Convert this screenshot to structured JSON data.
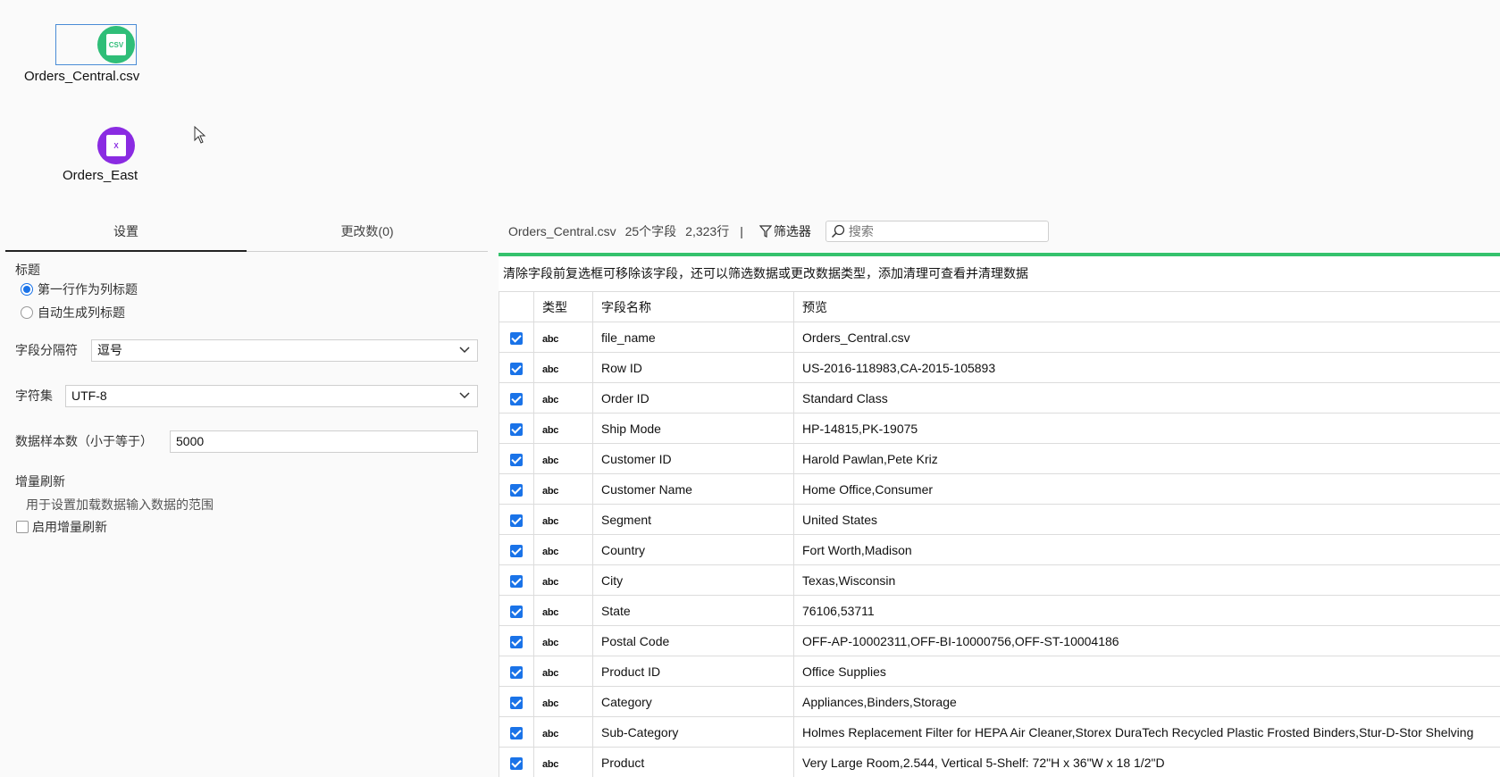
{
  "canvas": {
    "nodes": [
      {
        "label": "Orders_Central.csv",
        "icon": "csv-file-icon",
        "glyph": "CSV",
        "color": "#2fbe78"
      },
      {
        "label": "Orders_East",
        "icon": "excel-file-icon",
        "glyph": "X",
        "color": "#8a2be2"
      }
    ]
  },
  "settings": {
    "tabs": [
      {
        "label": "设置"
      },
      {
        "label": "更改数(0)"
      }
    ],
    "header_section": {
      "label": "标题",
      "options": [
        {
          "label": "第一行作为列标题",
          "selected": true
        },
        {
          "label": "自动生成列标题",
          "selected": false
        }
      ]
    },
    "delimiter": {
      "label": "字段分隔符",
      "value": "逗号"
    },
    "charset": {
      "label": "字符集",
      "value": "UTF-8"
    },
    "sample": {
      "label": "数据样本数（小于等于）",
      "value": "5000"
    },
    "incremental": {
      "label": "增量刷新",
      "description": "用于设置加载数据输入数据的范围",
      "checkbox_label": "启用增量刷新"
    }
  },
  "toolbar": {
    "file_name": "Orders_Central.csv",
    "field_count": "25个字段",
    "row_count": "2,323行",
    "separator": "|",
    "filter_label": "筛选器",
    "search_placeholder": "搜索"
  },
  "hint": "清除字段前复选框可移除该字段，还可以筛选数据或更改数据类型，添加清理可查看并清理数据",
  "table": {
    "columns": [
      "",
      "类型",
      "字段名称",
      "预览"
    ],
    "rows": [
      {
        "type": "abc",
        "name": "file_name",
        "preview": "Orders_Central.csv"
      },
      {
        "type": "abc",
        "name": "Row ID",
        "preview": "US-2016-118983,CA-2015-105893"
      },
      {
        "type": "abc",
        "name": "Order ID",
        "preview": "Standard Class"
      },
      {
        "type": "abc",
        "name": "Ship Mode",
        "preview": "HP-14815,PK-19075"
      },
      {
        "type": "abc",
        "name": "Customer ID",
        "preview": "Harold Pawlan,Pete Kriz"
      },
      {
        "type": "abc",
        "name": "Customer Name",
        "preview": "Home Office,Consumer"
      },
      {
        "type": "abc",
        "name": "Segment",
        "preview": "United States"
      },
      {
        "type": "abc",
        "name": "Country",
        "preview": "Fort Worth,Madison"
      },
      {
        "type": "abc",
        "name": "City",
        "preview": "Texas,Wisconsin"
      },
      {
        "type": "abc",
        "name": "State",
        "preview": "76106,53711"
      },
      {
        "type": "abc",
        "name": "Postal Code",
        "preview": "OFF-AP-10002311,OFF-BI-10000756,OFF-ST-10004186"
      },
      {
        "type": "abc",
        "name": "Product ID",
        "preview": "Office Supplies"
      },
      {
        "type": "abc",
        "name": "Category",
        "preview": "Appliances,Binders,Storage"
      },
      {
        "type": "abc",
        "name": "Sub-Category",
        "preview": "Holmes Replacement Filter for HEPA Air Cleaner,Storex DuraTech Recycled Plastic Frosted Binders,Stur-D-Stor Shelving"
      },
      {
        "type": "abc",
        "name": "Product",
        "preview": "Very Large Room,2.544, Vertical 5-Shelf: 72\"H x 36\"W x 18 1/2\"D"
      }
    ]
  }
}
